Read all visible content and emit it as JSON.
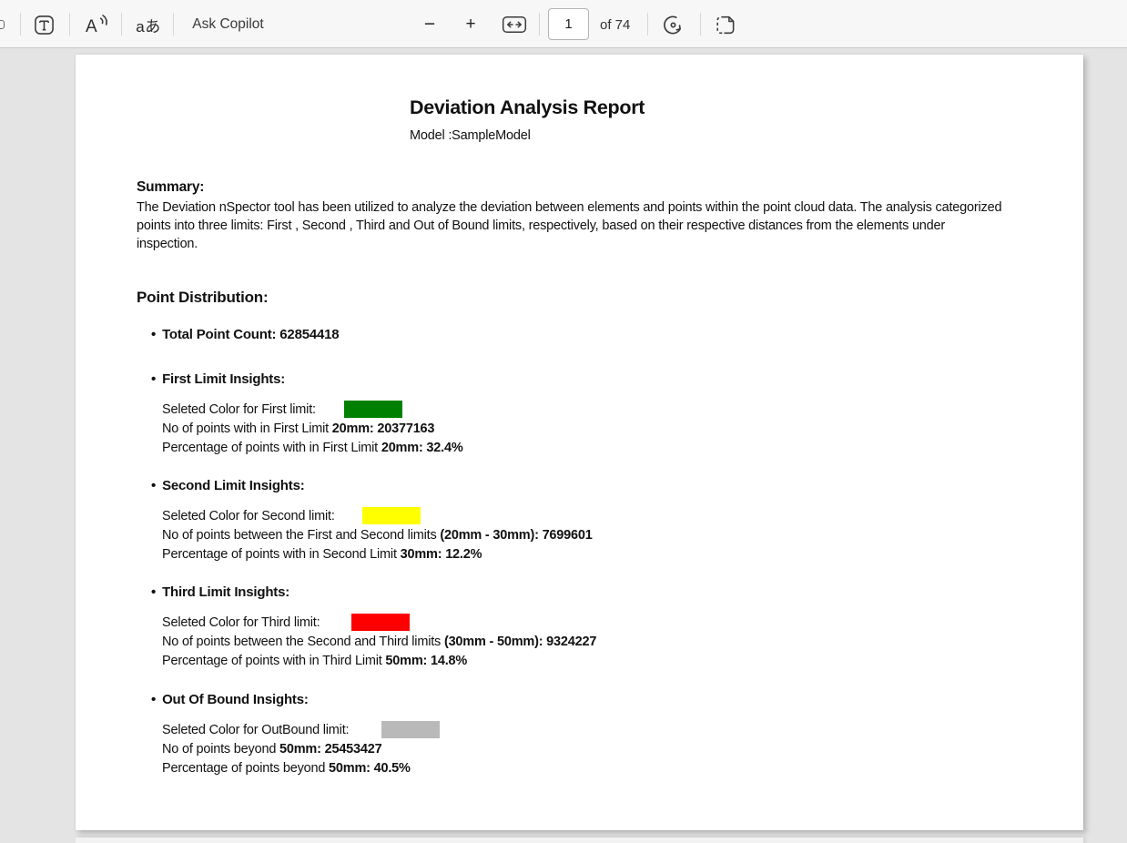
{
  "toolbar": {
    "text_select_glyph": "T",
    "read_aloud_glyph": "A",
    "translate_label": "aあ",
    "ask_copilot_label": "Ask Copilot",
    "zoom_out_glyph": "−",
    "zoom_in_glyph": "+",
    "page_number": "1",
    "page_count_label": "of 74",
    "icons": {
      "text-selection-icon": "letter T in rounded box",
      "read-aloud-icon": "letter A with sound waves",
      "translate-icon": "aあ text glyph",
      "zoom-out-icon": "minus sign",
      "zoom-in-icon": "plus sign",
      "fit-to-width-icon": "left-right arrows in rounded box",
      "rotate-icon": "circular arrow with center dot",
      "page-view-icon": "page with dashed left half"
    }
  },
  "document": {
    "title": "Deviation Analysis Report",
    "model_label": "Model :SampleModel",
    "summary": {
      "heading": "Summary:",
      "body": "The Deviation nSpector tool has been utilized to analyze the deviation between elements and points within the point cloud data. The analysis categorized points into three limits: First , Second , Third and Out of Bound limits, respectively, based on their respective distances from the elements under inspection."
    },
    "distribution": {
      "heading": "Point Distribution:",
      "bullet_char": "•",
      "total_points_label": "Total Point Count: 62854418",
      "sections": [
        {
          "heading": "First Limit Insights:",
          "color_label": "Seleted Color for First limit:",
          "swatch_color": "#008000",
          "count_text": "No of points with in First Limit ",
          "count_bold": "20mm: 20377163",
          "pct_text": "Percentage of points with in First Limit ",
          "pct_bold": "20mm: 32.4%"
        },
        {
          "heading": "Second Limit Insights:",
          "color_label": "Seleted Color for Second limit:",
          "swatch_color": "#ffff00",
          "count_text": "No of points between the First and Second limits ",
          "count_bold": "(20mm - 30mm): 7699601",
          "pct_text": "Percentage of points with in Second Limit ",
          "pct_bold": "30mm: 12.2%"
        },
        {
          "heading": "Third Limit Insights:",
          "color_label": "Seleted Color for Third limit:",
          "swatch_color": "#ff0000",
          "count_text": "No of points between the Second and Third limits ",
          "count_bold": "(30mm - 50mm): 9324227",
          "pct_text": "Percentage of points with in Third Limit ",
          "pct_bold": "50mm: 14.8%"
        },
        {
          "heading": "Out Of Bound Insights:",
          "color_label": "Seleted Color for OutBound limit:",
          "swatch_color": "#b9b9b9",
          "count_text": "No of points beyond ",
          "count_bold": "50mm: 25453427",
          "pct_text": "Percentage of points beyond ",
          "pct_bold": "50mm: 40.5%"
        }
      ]
    }
  }
}
